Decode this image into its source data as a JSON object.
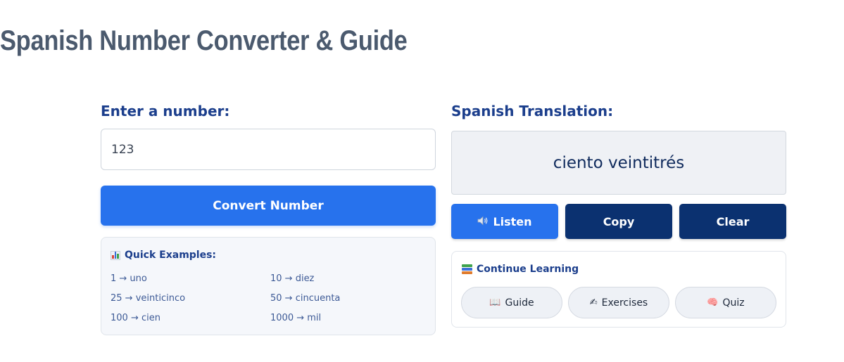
{
  "page": {
    "title": "Spanish Number Converter & Guide"
  },
  "input_section": {
    "label": "Enter a number:",
    "value": "123",
    "convert_label": "Convert Number"
  },
  "examples": {
    "title": "Quick Examples:",
    "icon": "bar-chart-icon",
    "items": [
      "1 → uno",
      "10 → diez",
      "25 → veinticinco",
      "50 → cincuenta",
      "100 → cien",
      "1000 → mil"
    ]
  },
  "output_section": {
    "label": "Spanish Translation:",
    "translation": "ciento veintitrés",
    "listen_label": "Listen",
    "listen_icon": "speaker-icon",
    "copy_label": "Copy",
    "clear_label": "Clear"
  },
  "learning": {
    "title": "Continue Learning",
    "icon": "books-icon",
    "links": [
      {
        "label": "Guide",
        "icon": "book-icon"
      },
      {
        "label": "Exercises",
        "icon": "writing-hand-icon"
      },
      {
        "label": "Quiz",
        "icon": "brain-icon"
      }
    ]
  },
  "colors": {
    "primary_blue": "#2772ed",
    "dark_navy": "#0b3170",
    "heading_blue": "#1b3e8c",
    "title_gray": "#4b5a6e"
  }
}
